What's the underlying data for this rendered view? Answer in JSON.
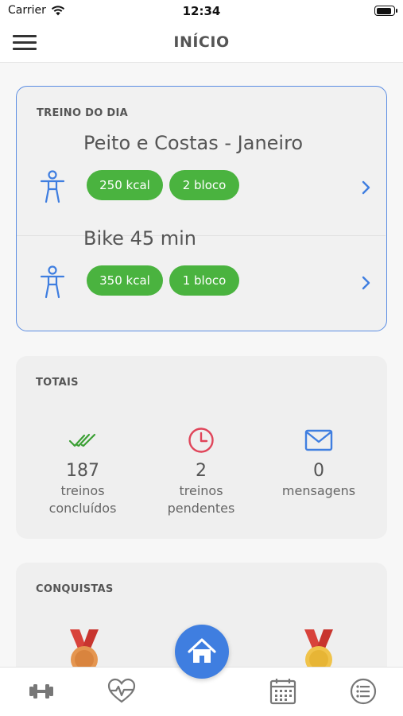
{
  "status_bar": {
    "carrier": "Carrier",
    "time": "12:34",
    "battery_level": 0.9
  },
  "header": {
    "title": "INÍCIO",
    "menu_icon": "hamburger-icon"
  },
  "workouts": {
    "label": "TREINO DO DIA",
    "items": [
      {
        "title": "Peito e Costas - Janeiro",
        "kcal": "250 kcal",
        "blocks": "2 bloco"
      },
      {
        "title": "Bike 45 min",
        "kcal": "350 kcal",
        "blocks": "1 bloco"
      }
    ]
  },
  "totals": {
    "label": "TOTAIS",
    "stats": [
      {
        "value": "187",
        "line1": "treinos",
        "line2": "concluídos",
        "icon": "double-check-icon"
      },
      {
        "value": "2",
        "line1": "treinos",
        "line2": "pendentes",
        "icon": "clock-icon"
      },
      {
        "value": "0",
        "line1": "mensagens",
        "line2": "",
        "icon": "mail-icon"
      }
    ]
  },
  "achievements": {
    "label": "CONQUISTAS",
    "medals": [
      "bronze-medal",
      "silver-medal",
      "gold-medal"
    ]
  },
  "tabs": [
    "dumbbell-icon",
    "heart-pulse-icon",
    "home-icon",
    "calendar-icon",
    "list-icon"
  ],
  "colors": {
    "accent": "#3f7ee0",
    "badge_green": "#4ab33f",
    "check_green": "#3a9f33",
    "clock_red": "#e0455a",
    "mail_blue": "#3f7ee0"
  }
}
